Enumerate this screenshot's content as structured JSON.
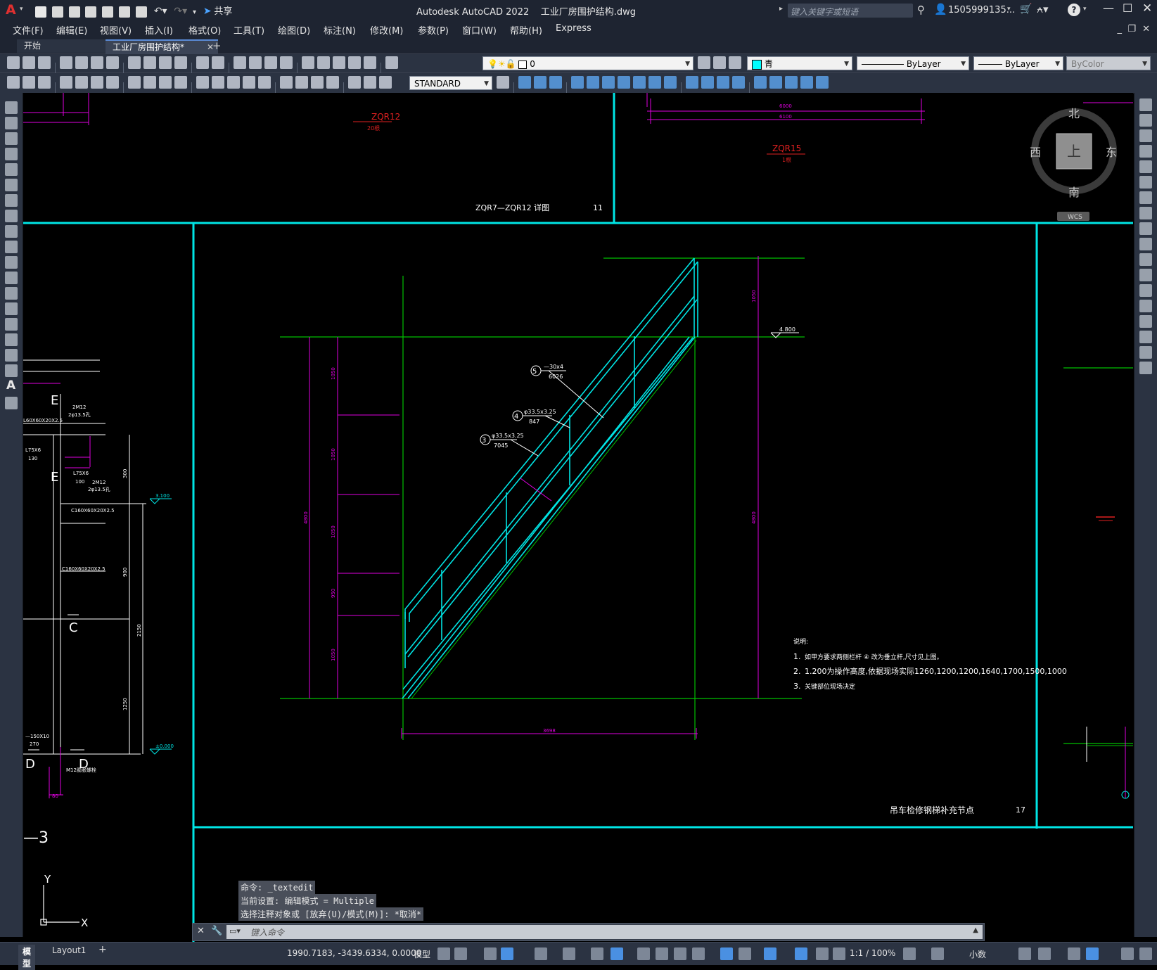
{
  "app": {
    "logo": "A",
    "title": "Autodesk AutoCAD 2022",
    "filename": "工业厂房围护结构.dwg",
    "share_label": "共享",
    "search_placeholder": "键入关键字或短语",
    "user": "1505999135...",
    "icons": [
      "new-icon",
      "open-icon",
      "save-icon",
      "saveas-icon",
      "publish-icon",
      "print-icon",
      "undo-icon",
      "redo-icon",
      "share-icon",
      "search-icon",
      "user-icon",
      "cart-icon",
      "help-icon",
      "minimize-icon",
      "maximize-icon",
      "close-icon"
    ]
  },
  "menu": [
    "文件(F)",
    "编辑(E)",
    "视图(V)",
    "插入(I)",
    "格式(O)",
    "工具(T)",
    "绘图(D)",
    "标注(N)",
    "修改(M)",
    "参数(P)",
    "窗口(W)",
    "帮助(H)",
    "Express"
  ],
  "tabs": {
    "start": "开始",
    "active": "工业厂房围护结构*",
    "add": "+"
  },
  "toolbar": {
    "layer_value": "0",
    "color_value": "青",
    "linetype_value": "ByLayer",
    "lineweight_value": "ByLayer",
    "plotstyle_value": "ByColor",
    "textstyle_value": "STANDARD",
    "accent_color": "#00ffff"
  },
  "viewcube": {
    "north": "北",
    "south": "南",
    "east": "东",
    "west": "西",
    "top": "上",
    "wcs": "WCS"
  },
  "drawing": {
    "detail_title_1": "ZQR7—ZQR12 详图",
    "detail_num_1": "11",
    "tag_zqr12": "ZQR12",
    "tag_zqr12_sub": "20根",
    "tag_zqr15": "ZQR15",
    "tag_zqr15_sub": "1根",
    "dim_6000": "6000",
    "dim_6100": "6100",
    "elev_top": "4.800",
    "callout_5": "5",
    "callout_5_spec": "—30x4",
    "callout_5_len": "6026",
    "callout_4": "4",
    "callout_4_spec": "φ33.5x3.25",
    "callout_4_len": "847",
    "callout_3": "3",
    "callout_3_spec": "φ33.5x3.25",
    "callout_3_len": "7045",
    "dim_bottom": "3698",
    "dim_left_total": "4800",
    "dim_right_total": "4800",
    "dim_seg_1": "1050",
    "dim_seg_2": "1050",
    "dim_seg_3": "1050",
    "dim_seg_4": "950",
    "dim_seg_5": "1050",
    "dim_right_top": "1050",
    "notes_title": "说明:",
    "note_1_num": "1.",
    "note_1": "如甲方要求两侧栏杆 ④ 改为垂立杆,尺寸见上图。",
    "note_2_num": "2.",
    "note_2": "1.200为操作高度,依据现场实际1260,1200,1200,1640,1700,1500,1000",
    "note_3_num": "3.",
    "note_3": "关键部位现场决定",
    "detail_title_2": "吊车检修钢梯补充节点",
    "detail_num_2": "17",
    "left_label_E1": "E",
    "left_label_E2": "E",
    "left_label_C": "C",
    "left_label_D1": "D",
    "left_label_D2": "D",
    "left_2m12_a": "2M12",
    "left_2m12_a2": "2φ13.5孔",
    "left_l75": "L75X6",
    "left_130": "130",
    "left_l75b": "L75X6",
    "left_100": "100",
    "left_2m12_b": "2M12",
    "left_2m12_b2": "2φ13.5孔",
    "left_c160": "C160X60X20X2.5",
    "left_c160b": "C160X60X20X2.5",
    "left_l60": "L60X60X20X2.5",
    "left_elev_3": "3.100",
    "left_elev_0": "±0.000",
    "left_300": "300",
    "left_900": "900",
    "left_2150": "2150",
    "left_1250": "1250",
    "left_150": "—150X10",
    "left_270": "270",
    "left_m12": "M12膨胀螺栓",
    "left_80": "80",
    "left_sec": "—3",
    "ucs_x": "X",
    "ucs_y": "Y"
  },
  "command": {
    "line1": "命令: _textedit",
    "line2": "当前设置: 编辑模式 = Multiple",
    "line3": "选择注释对象或 [放弃(U)/模式(M)]: *取消*",
    "placeholder": "键入命令"
  },
  "layout_tabs": [
    "模型",
    "Layout1",
    "+"
  ],
  "status": {
    "coords": "1990.7183, -3439.6334, 0.0000",
    "space": "模型",
    "scale": "1:1 / 100%",
    "units": "小数"
  }
}
